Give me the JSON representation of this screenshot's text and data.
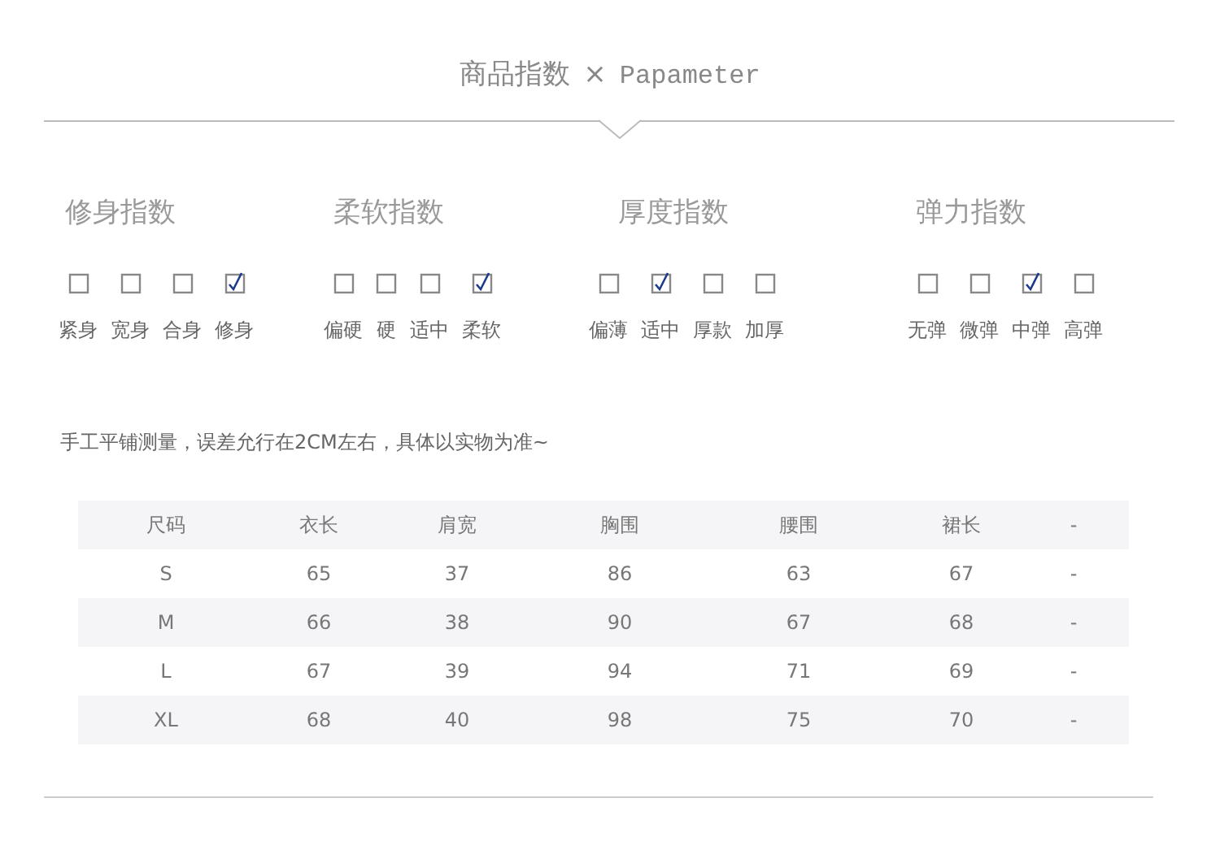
{
  "header": {
    "title": "商品指数",
    "separator": "×",
    "subtitle": "Papameter"
  },
  "indices": [
    {
      "title": "修身指数",
      "options": [
        {
          "label": "紧身",
          "checked": false
        },
        {
          "label": "宽身",
          "checked": false
        },
        {
          "label": "合身",
          "checked": false
        },
        {
          "label": "修身",
          "checked": true
        }
      ]
    },
    {
      "title": "柔软指数",
      "options": [
        {
          "label": "偏硬",
          "checked": false
        },
        {
          "label": "硬",
          "checked": false
        },
        {
          "label": "适中",
          "checked": false
        },
        {
          "label": "柔软",
          "checked": true
        }
      ]
    },
    {
      "title": "厚度指数",
      "options": [
        {
          "label": "偏薄",
          "checked": false
        },
        {
          "label": "适中",
          "checked": true
        },
        {
          "label": "厚款",
          "checked": false
        },
        {
          "label": "加厚",
          "checked": false
        }
      ]
    },
    {
      "title": "弹力指数",
      "options": [
        {
          "label": "无弹",
          "checked": false
        },
        {
          "label": "微弹",
          "checked": false
        },
        {
          "label": "中弹",
          "checked": true
        },
        {
          "label": "高弹",
          "checked": false
        }
      ]
    }
  ],
  "note": "手工平铺测量，误差允行在2CM左右，具体以实物为准~",
  "table": {
    "columns": [
      "尺码",
      "衣长",
      "肩宽",
      "胸围",
      "腰围",
      "裙长",
      "-"
    ],
    "rows": [
      [
        "S",
        "65",
        "37",
        "86",
        "63",
        "67",
        "-"
      ],
      [
        "M",
        "66",
        "38",
        "90",
        "67",
        "68",
        "-"
      ],
      [
        "L",
        "67",
        "39",
        "94",
        "71",
        "69",
        "-"
      ],
      [
        "XL",
        "68",
        "40",
        "98",
        "75",
        "70",
        "-"
      ]
    ]
  }
}
